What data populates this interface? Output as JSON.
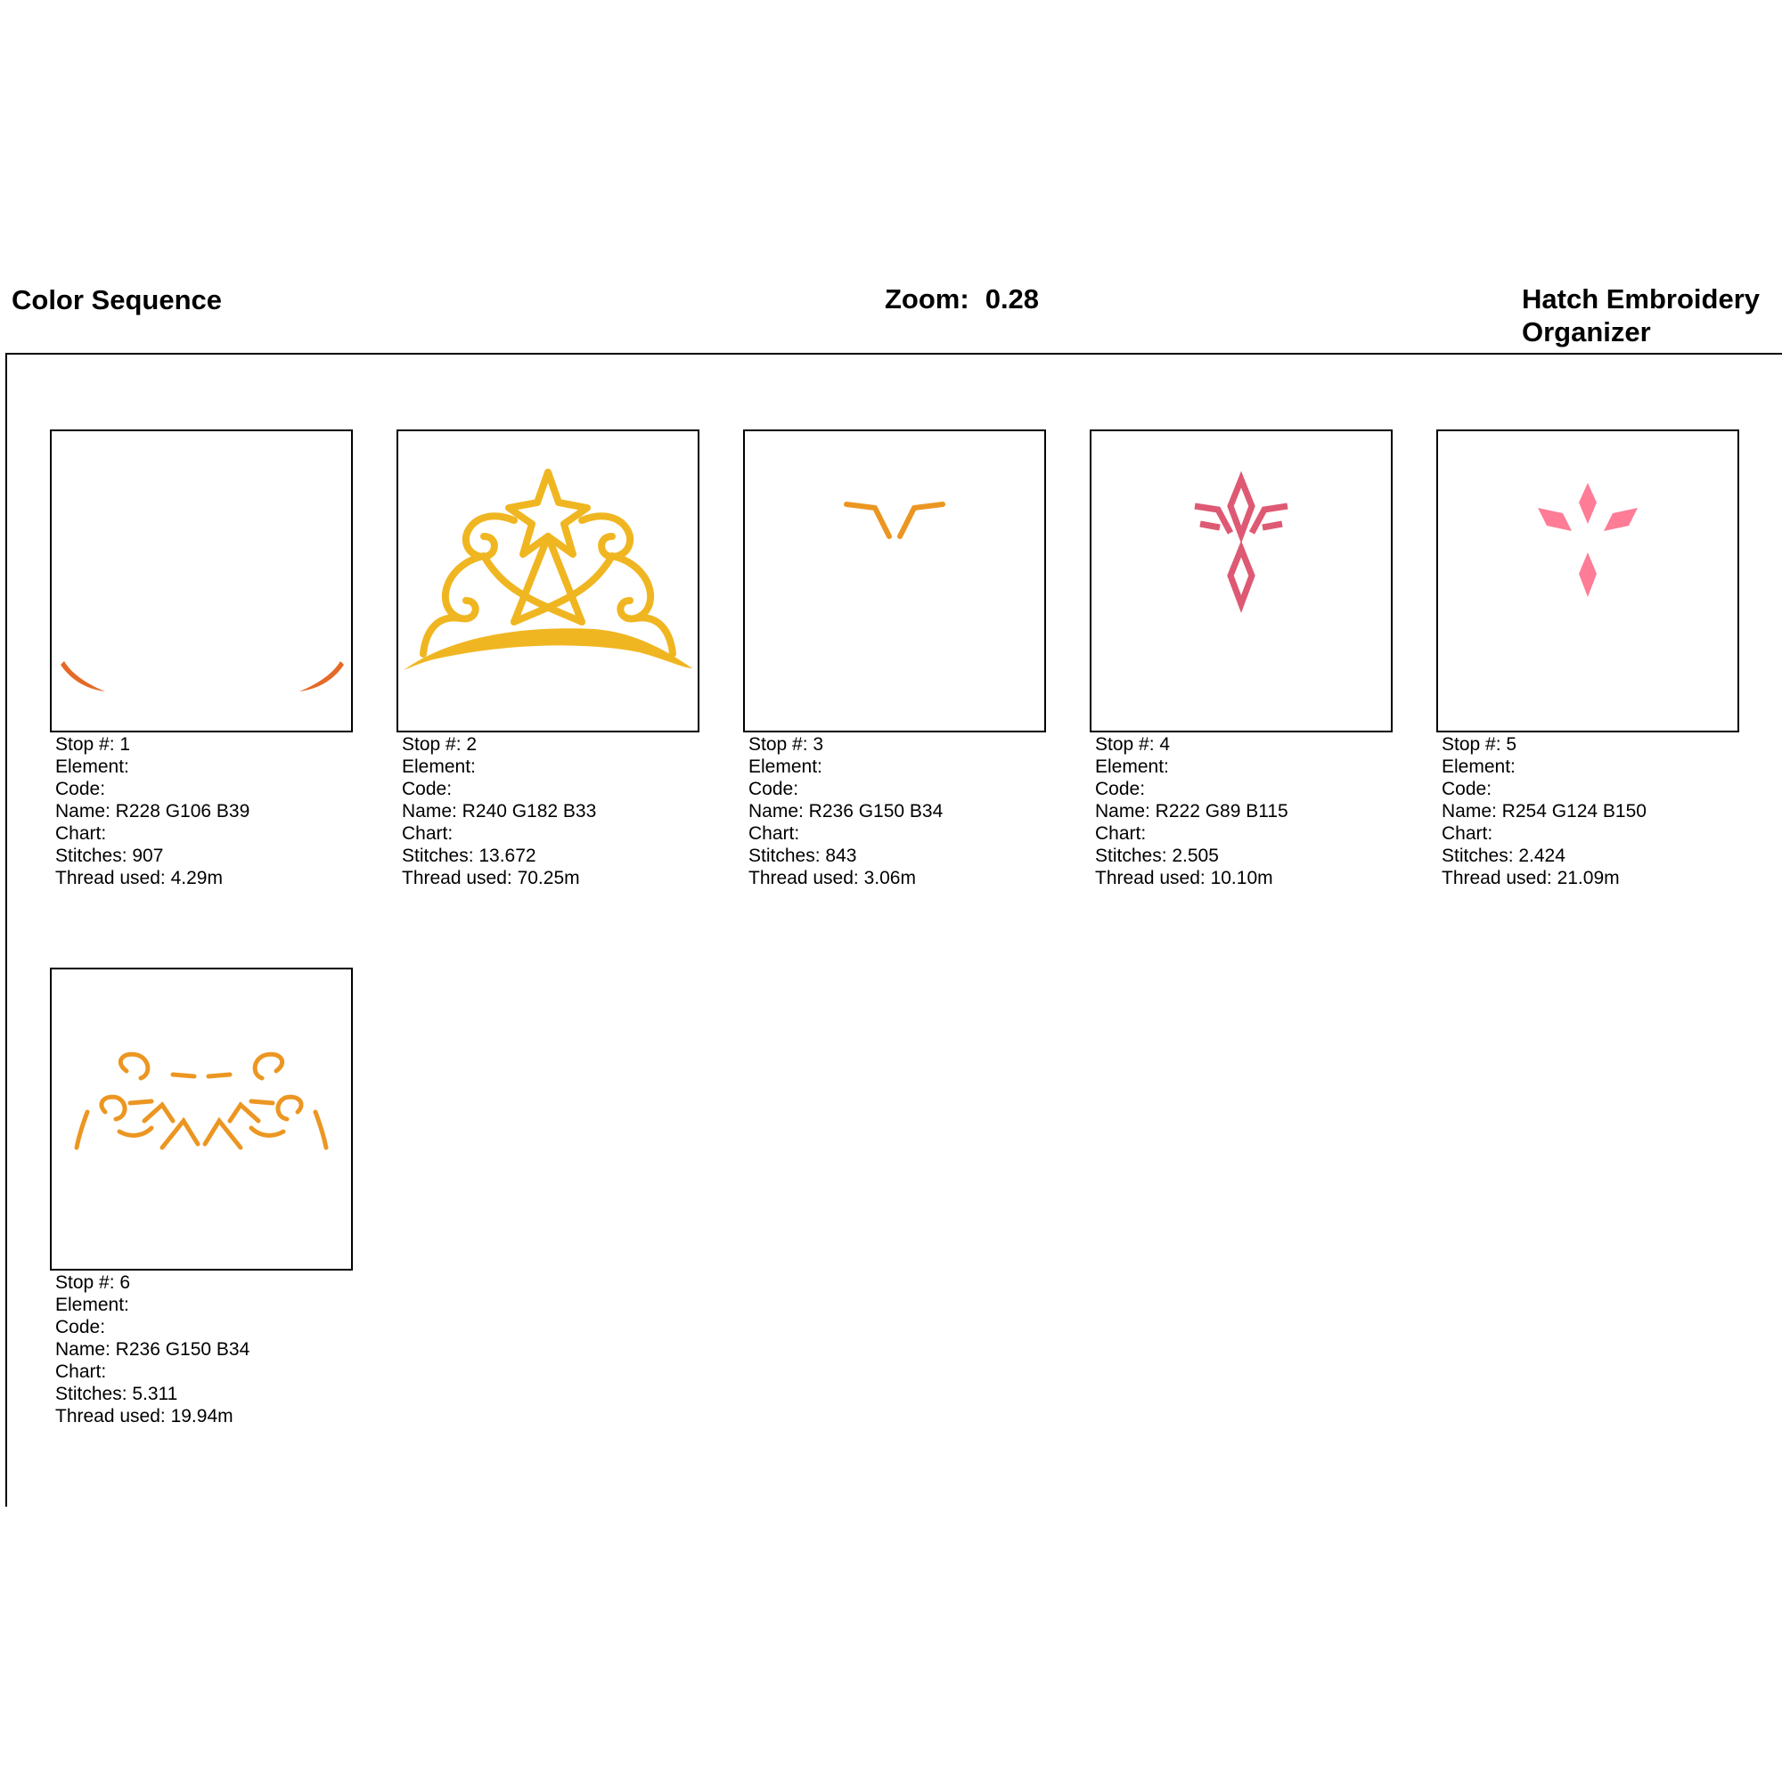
{
  "header": {
    "title": "Color Sequence",
    "zoom_label": "Zoom:",
    "zoom_value": "0.28",
    "app_line1": "Hatch Embroidery",
    "app_line2": "Organizer"
  },
  "stops": [
    {
      "stop": "Stop #: 1",
      "element": "Element:",
      "code": "Code:",
      "name": "Name: R228 G106 B39",
      "chart": "Chart:",
      "stitches": "Stitches: 907",
      "thread": "Thread used: 4.29m",
      "color": "#e46a27",
      "icon": "side-accents-icon"
    },
    {
      "stop": "Stop #: 2",
      "element": "Element:",
      "code": "Code:",
      "name": "Name: R240 G182 B33",
      "chart": "Chart:",
      "stitches": "Stitches: 13.672",
      "thread": "Thread used: 70.25m",
      "color": "#f0b621",
      "icon": "tiara-icon"
    },
    {
      "stop": "Stop #: 3",
      "element": "Element:",
      "code": "Code:",
      "name": "Name: R236 G150 B34",
      "chart": "Chart:",
      "stitches": "Stitches: 843",
      "thread": "Thread used: 3.06m",
      "color": "#ec9622",
      "icon": "v-accent-icon"
    },
    {
      "stop": "Stop #: 4",
      "element": "Element:",
      "code": "Code:",
      "name": "Name: R222 G89 B115",
      "chart": "Chart:",
      "stitches": "Stitches: 2.505",
      "thread": "Thread used: 10.10m",
      "color": "#de5973",
      "icon": "gem-outline-icon"
    },
    {
      "stop": "Stop #: 5",
      "element": "Element:",
      "code": "Code:",
      "name": "Name: R254 G124 B150",
      "chart": "Chart:",
      "stitches": "Stitches: 2.424",
      "thread": "Thread used: 21.09m",
      "color": "#fe7c96",
      "icon": "gem-fill-icon"
    },
    {
      "stop": "Stop #: 6",
      "element": "Element:",
      "code": "Code:",
      "name": "Name: R236 G150 B34",
      "chart": "Chart:",
      "stitches": "Stitches: 5.311",
      "thread": "Thread used: 19.94m",
      "color": "#ec9622",
      "icon": "scroll-detail-icon"
    }
  ]
}
